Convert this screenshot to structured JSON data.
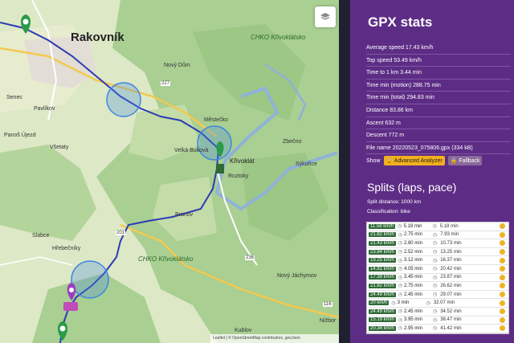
{
  "map": {
    "places": {
      "rakovnik": "Rakovník",
      "chko_top": "CHKO Křivoklátsko",
      "krivoklat": "Křivoklát",
      "novy_dum": "Nový Dům",
      "senec": "Senec",
      "pavlikov": "Pavlíkov",
      "panos_ujezd": "Panoš Újezd",
      "vsetaty": "Všetaty",
      "mestecko": "Městečko",
      "velka_bukova": "Velká Buková",
      "roztoky": "Roztoky",
      "zbecno": "Zbečno",
      "sykorice": "Sýkořice",
      "branov": "Branov",
      "slabce": "Slabce",
      "hrebecniky": "Hřebečníky",
      "chko_bottom": "CHKO Křivoklátsko",
      "novy_jachymov": "Nový Jáchymov",
      "kublov": "Kublov",
      "nizbor": "Nižbor",
      "road_227": "227",
      "road_236": "236",
      "road_201": "201",
      "road_116": "116"
    },
    "attribution": "Leaflet | © OpenStreetMap contributors, geoJson"
  },
  "panel": {
    "title": "GPX stats",
    "stats": [
      {
        "label": "Average speed",
        "value": "17.43 km/h"
      },
      {
        "label": "Top speed",
        "value": "53.49 km/h"
      },
      {
        "label": "Time to 1 km",
        "value": "3.44 min"
      },
      {
        "label": "Time min (motion)",
        "value": "288.75 min"
      },
      {
        "label": "Time min (total)",
        "value": "294.83 min"
      },
      {
        "label": "Distance",
        "value": "83.86 km"
      },
      {
        "label": "Ascent",
        "value": "632 m"
      },
      {
        "label": "Descent",
        "value": "772 m"
      },
      {
        "label": "File name",
        "value": "20220523_075806.gpx (334 kB)"
      }
    ],
    "show_label": "Show",
    "advanced_button": "Advanced Analyzer",
    "fallback_button": "Fallback",
    "splits_title": "Splits (laps, pace)",
    "split_distance": "Split distance: 1000 km",
    "classification": "Classification: bike",
    "splits": [
      {
        "speed": "11.58 km/h",
        "time": "5.18 min",
        "total": "5.18 min"
      },
      {
        "speed": "21.82 km/h",
        "time": "2.75 min",
        "total": "7.93 min"
      },
      {
        "speed": "21.43 km/h",
        "time": "2.80 min",
        "total": "10.73 min"
      },
      {
        "speed": "23.84 km/h",
        "time": "2.52 min",
        "total": "13.25 min"
      },
      {
        "speed": "19.25 km/h",
        "time": "3.12 min",
        "total": "16.37 min"
      },
      {
        "speed": "14.81 km/h",
        "time": "4.05 min",
        "total": "20.42 min"
      },
      {
        "speed": "17.39 km/h",
        "time": "3.45 min",
        "total": "23.87 min"
      },
      {
        "speed": "21.82 km/h",
        "time": "2.75 min",
        "total": "26.62 min"
      },
      {
        "speed": "24.49 km/h",
        "time": "2.45 min",
        "total": "29.07 min"
      },
      {
        "speed": "20 km/h",
        "time": "3 min",
        "total": "32.07 min"
      },
      {
        "speed": "24.49 km/h",
        "time": "2.45 min",
        "total": "34.52 min"
      },
      {
        "speed": "15.19 km/h",
        "time": "3.95 min",
        "total": "38.47 min"
      },
      {
        "speed": "20.34 km/h",
        "time": "2.95 min",
        "total": "41.42 min"
      }
    ]
  }
}
